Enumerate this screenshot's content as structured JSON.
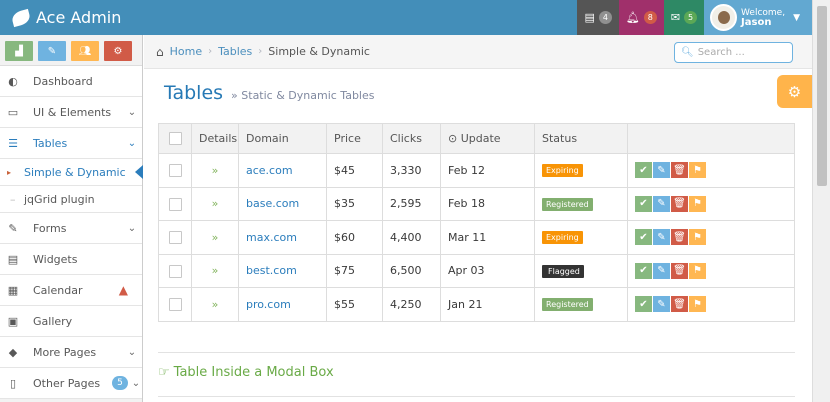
{
  "brand": {
    "name": "Ace Admin"
  },
  "navbar": {
    "tasks_count": "4",
    "notifications_count": "8",
    "messages_count": "5",
    "welcome": "Welcome,",
    "user": "Jason"
  },
  "sidebar": {
    "items": [
      {
        "label": "Dashboard"
      },
      {
        "label": "UI & Elements"
      },
      {
        "label": "Tables"
      },
      {
        "label": "Simple & Dynamic"
      },
      {
        "label": "jqGrid plugin"
      },
      {
        "label": "Forms"
      },
      {
        "label": "Widgets"
      },
      {
        "label": "Calendar"
      },
      {
        "label": "Gallery"
      },
      {
        "label": "More Pages"
      },
      {
        "label": "Other Pages",
        "badge": "5"
      }
    ]
  },
  "breadcrumb": {
    "home": "Home",
    "tables": "Tables",
    "current": "Simple & Dynamic"
  },
  "search": {
    "placeholder": "Search ..."
  },
  "page": {
    "title": "Tables",
    "subtitle": "» Static & Dynamic Tables"
  },
  "table": {
    "headers": [
      "Details",
      "Domain",
      "Price",
      "Clicks",
      "Update",
      "Status"
    ],
    "rows": [
      {
        "domain": "ace.com",
        "price": "$45",
        "clicks": "3,330",
        "update": "Feb 12",
        "status": "Expiring"
      },
      {
        "domain": "base.com",
        "price": "$35",
        "clicks": "2,595",
        "update": "Feb 18",
        "status": "Registered"
      },
      {
        "domain": "max.com",
        "price": "$60",
        "clicks": "4,400",
        "update": "Mar 11",
        "status": "Expiring"
      },
      {
        "domain": "best.com",
        "price": "$75",
        "clicks": "6,500",
        "update": "Apr 03",
        "status": "Flagged"
      },
      {
        "domain": "pro.com",
        "price": "$55",
        "clicks": "4,250",
        "update": "Jan 21",
        "status": "Registered"
      }
    ]
  },
  "modal_section": {
    "title": "Table Inside a Modal Box"
  }
}
